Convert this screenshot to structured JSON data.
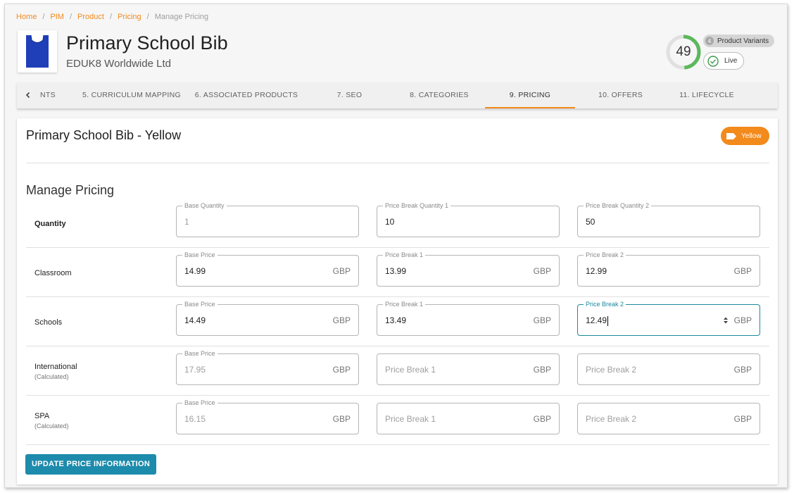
{
  "breadcrumb": {
    "items": [
      "Home",
      "PIM",
      "Product",
      "Pricing"
    ],
    "current": "Manage Pricing"
  },
  "product": {
    "title": "Primary School Bib",
    "company": "EDUK8 Worldwide Ltd",
    "score": "49",
    "score_fraction": 0.49,
    "variants_count": "4",
    "variants_label": "Product Variants",
    "status": "Live"
  },
  "tabs": [
    {
      "label": "NTS"
    },
    {
      "label": "5. CURRICULUM MAPPING"
    },
    {
      "label": "6. ASSOCIATED PRODUCTS"
    },
    {
      "label": "7. SEO"
    },
    {
      "label": "8. CATEGORIES"
    },
    {
      "label": "9. PRICING"
    },
    {
      "label": "10. OFFERS"
    },
    {
      "label": "11. LIFECYCLE"
    }
  ],
  "variant": {
    "title": "Primary School Bib - Yellow",
    "color_label": "Yellow"
  },
  "pricing": {
    "section_title": "Manage Pricing",
    "currency": "GBP",
    "rows": [
      {
        "label": "Quantity",
        "sub": "",
        "fields": [
          {
            "legend": "Base Quantity",
            "value": "1",
            "placeholder": ""
          },
          {
            "legend": "Price Break Quantity 1",
            "value": "10",
            "placeholder": ""
          },
          {
            "legend": "Price Break Quantity 2",
            "value": "50",
            "placeholder": ""
          }
        ]
      },
      {
        "label": "Classroom",
        "sub": "",
        "fields": [
          {
            "legend": "Base Price",
            "value": "14.99",
            "placeholder": ""
          },
          {
            "legend": "Price Break 1",
            "value": "13.99",
            "placeholder": ""
          },
          {
            "legend": "Price Break 2",
            "value": "12.99",
            "placeholder": ""
          }
        ]
      },
      {
        "label": "Schools",
        "sub": "",
        "fields": [
          {
            "legend": "Base Price",
            "value": "14.49",
            "placeholder": ""
          },
          {
            "legend": "Price Break 1",
            "value": "13.49",
            "placeholder": ""
          },
          {
            "legend": "Price Break 2",
            "value": "12.49",
            "placeholder": ""
          }
        ]
      },
      {
        "label": "International",
        "sub": "(Calculated)",
        "fields": [
          {
            "legend": "Base Price",
            "value": "17.95",
            "placeholder": ""
          },
          {
            "legend": "",
            "value": "",
            "placeholder": "Price Break 1"
          },
          {
            "legend": "",
            "value": "",
            "placeholder": "Price Break 2"
          }
        ]
      },
      {
        "label": "SPA",
        "sub": "(Calculated)",
        "fields": [
          {
            "legend": "Base Price",
            "value": "16.15",
            "placeholder": ""
          },
          {
            "legend": "",
            "value": "",
            "placeholder": "Price Break 1"
          },
          {
            "legend": "",
            "value": "",
            "placeholder": "Price Break 2"
          }
        ]
      }
    ],
    "update_button": "UPDATE PRICE INFORMATION"
  },
  "colors": {
    "accent": "#f28a1c",
    "primary_button": "#1d8bac",
    "focus": "#1a8a9e",
    "score_ring": "#5cb85c",
    "bib": "#1f3fb8"
  }
}
